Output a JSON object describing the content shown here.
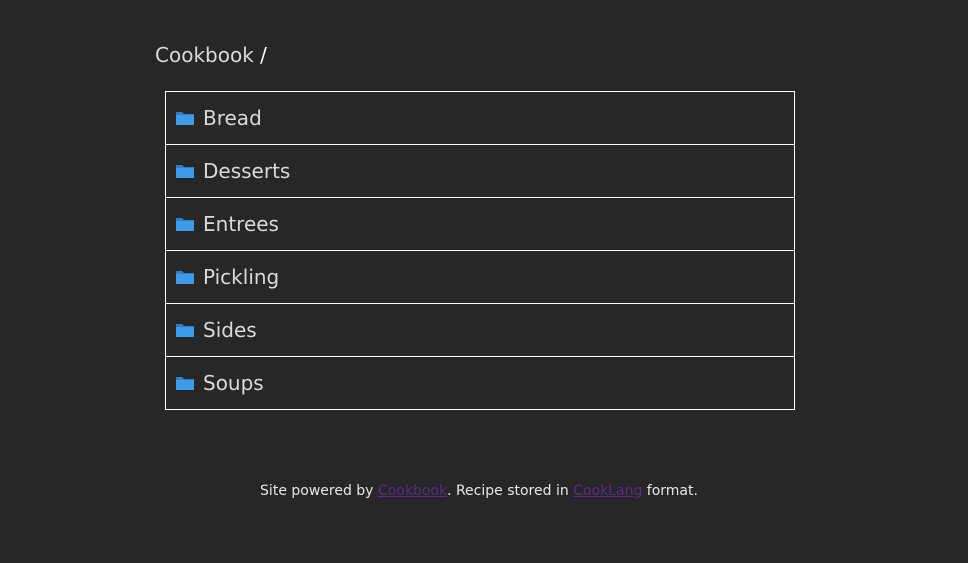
{
  "breadcrumb": {
    "root_label": "Cookbook",
    "separator": "/"
  },
  "folders": [
    {
      "label": "Bread",
      "icon": "folder-icon"
    },
    {
      "label": "Desserts",
      "icon": "folder-icon"
    },
    {
      "label": "Entrees",
      "icon": "folder-icon"
    },
    {
      "label": "Pickling",
      "icon": "folder-icon"
    },
    {
      "label": "Sides",
      "icon": "folder-icon"
    },
    {
      "label": "Soups",
      "icon": "folder-icon"
    }
  ],
  "footer": {
    "text_before": "Site powered by ",
    "link1_label": "Cookbook",
    "text_middle": ". Recipe stored in ",
    "link2_label": "CookLang",
    "text_after": " format."
  },
  "colors": {
    "background": "#272727",
    "folder_icon": "#3d9be9",
    "link": "#5a2a8f"
  }
}
